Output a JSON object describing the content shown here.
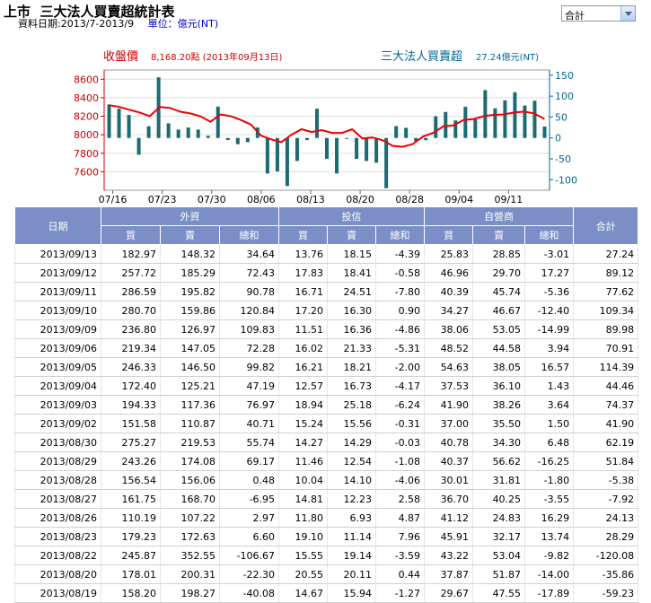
{
  "header": {
    "title_market": "上市",
    "title_main": "三大法人買賣超統計表",
    "date_range": "資料日期:2013/7-2013/9",
    "unit_label": "單位：億元(NT)"
  },
  "filter": {
    "selected": "合計"
  },
  "chart_legend": {
    "price_label": "收盤價",
    "price_value": "8,168.20點 (2013年09月13日)",
    "net_label": "三大法人買賣超",
    "net_value": "27.24億元(NT)"
  },
  "chart_data": {
    "type": "bar+line",
    "x_tick_labels": [
      "07/16",
      "07/23",
      "07/30",
      "08/06",
      "08/13",
      "08/20",
      "08/28",
      "09/04",
      "09/11"
    ],
    "left_axis": {
      "label": "收盤價",
      "ticks": [
        7600,
        7800,
        8000,
        8200,
        8400,
        8600
      ],
      "range": [
        7400,
        8700
      ],
      "color": "#cc0000"
    },
    "right_axis": {
      "label": "三大法人買賣超",
      "ticks": [
        -100,
        -50,
        0,
        50,
        100,
        150
      ],
      "range": [
        -125,
        162.5
      ],
      "color": "#006699"
    },
    "dates": [
      "07/16",
      "07/17",
      "07/18",
      "07/19",
      "07/22",
      "07/23",
      "07/24",
      "07/25",
      "07/26",
      "07/29",
      "07/30",
      "07/31",
      "08/01",
      "08/02",
      "08/05",
      "08/06",
      "08/07",
      "08/08",
      "08/09",
      "08/12",
      "08/13",
      "08/14",
      "08/15",
      "08/16",
      "08/19",
      "08/20",
      "08/21",
      "08/22",
      "08/23",
      "08/26",
      "08/27",
      "08/28",
      "08/29",
      "08/30",
      "09/02",
      "09/03",
      "09/04",
      "09/05",
      "09/06",
      "09/09",
      "09/10",
      "09/11",
      "09/12",
      "09/13"
    ],
    "net_buy_sell": [
      80,
      70,
      55,
      -40,
      28,
      145,
      35,
      20,
      25,
      20,
      5,
      75,
      -5,
      -15,
      -10,
      25,
      -85,
      -80,
      -115,
      -55,
      -5,
      70,
      -50,
      -85,
      0,
      -50,
      -55,
      -59.23,
      -120.08,
      28.29,
      24.13,
      -7.92,
      -5.38,
      51.84,
      62.19,
      41.9,
      74.37,
      44.46,
      114.39,
      70.91,
      89.98,
      109.34,
      77.62,
      89.12,
      27.24
    ],
    "close_price": [
      8320,
      8300,
      8270,
      8240,
      8200,
      8300,
      8290,
      8250,
      8230,
      8200,
      8140,
      8220,
      8200,
      8160,
      8110,
      7990,
      7950,
      7920,
      8000,
      8060,
      8030,
      8050,
      8020,
      8020,
      8060,
      7960,
      7970,
      7940,
      7880,
      7870,
      7900,
      7980,
      8020,
      8090,
      8100,
      8160,
      8170,
      8200,
      8215,
      8220,
      8240,
      8250,
      8230,
      8168.2
    ]
  },
  "table": {
    "headers": {
      "date": "日期",
      "foreign": "外資",
      "trust": "投信",
      "dealer": "自營商",
      "total": "合計",
      "buy": "買",
      "sell": "賣",
      "net": "總和"
    },
    "rows": [
      {
        "date": "2013/09/13",
        "f_buy": "182.97",
        "f_sell": "148.32",
        "f_net": "34.64",
        "t_buy": "13.76",
        "t_sell": "18.15",
        "t_net": "-4.39",
        "d_buy": "25.83",
        "d_sell": "28.85",
        "d_net": "-3.01",
        "total": "27.24"
      },
      {
        "date": "2013/09/12",
        "f_buy": "257.72",
        "f_sell": "185.29",
        "f_net": "72.43",
        "t_buy": "17.83",
        "t_sell": "18.41",
        "t_net": "-0.58",
        "d_buy": "46.96",
        "d_sell": "29.70",
        "d_net": "17.27",
        "total": "89.12"
      },
      {
        "date": "2013/09/11",
        "f_buy": "286.59",
        "f_sell": "195.82",
        "f_net": "90.78",
        "t_buy": "16.71",
        "t_sell": "24.51",
        "t_net": "-7.80",
        "d_buy": "40.39",
        "d_sell": "45.74",
        "d_net": "-5.36",
        "total": "77.62"
      },
      {
        "date": "2013/09/10",
        "f_buy": "280.70",
        "f_sell": "159.86",
        "f_net": "120.84",
        "t_buy": "17.20",
        "t_sell": "16.30",
        "t_net": "0.90",
        "d_buy": "34.27",
        "d_sell": "46.67",
        "d_net": "-12.40",
        "total": "109.34"
      },
      {
        "date": "2013/09/09",
        "f_buy": "236.80",
        "f_sell": "126.97",
        "f_net": "109.83",
        "t_buy": "11.51",
        "t_sell": "16.36",
        "t_net": "-4.86",
        "d_buy": "38.06",
        "d_sell": "53.05",
        "d_net": "-14.99",
        "total": "89.98"
      },
      {
        "date": "2013/09/06",
        "f_buy": "219.34",
        "f_sell": "147.05",
        "f_net": "72.28",
        "t_buy": "16.02",
        "t_sell": "21.33",
        "t_net": "-5.31",
        "d_buy": "48.52",
        "d_sell": "44.58",
        "d_net": "3.94",
        "total": "70.91"
      },
      {
        "date": "2013/09/05",
        "f_buy": "246.33",
        "f_sell": "146.50",
        "f_net": "99.82",
        "t_buy": "16.21",
        "t_sell": "18.21",
        "t_net": "-2.00",
        "d_buy": "54.63",
        "d_sell": "38.05",
        "d_net": "16.57",
        "total": "114.39"
      },
      {
        "date": "2013/09/04",
        "f_buy": "172.40",
        "f_sell": "125.21",
        "f_net": "47.19",
        "t_buy": "12.57",
        "t_sell": "16.73",
        "t_net": "-4.17",
        "d_buy": "37.53",
        "d_sell": "36.10",
        "d_net": "1.43",
        "total": "44.46"
      },
      {
        "date": "2013/09/03",
        "f_buy": "194.33",
        "f_sell": "117.36",
        "f_net": "76.97",
        "t_buy": "18.94",
        "t_sell": "25.18",
        "t_net": "-6.24",
        "d_buy": "41.90",
        "d_sell": "38.26",
        "d_net": "3.64",
        "total": "74.37"
      },
      {
        "date": "2013/09/02",
        "f_buy": "151.58",
        "f_sell": "110.87",
        "f_net": "40.71",
        "t_buy": "15.24",
        "t_sell": "15.56",
        "t_net": "-0.31",
        "d_buy": "37.00",
        "d_sell": "35.50",
        "d_net": "1.50",
        "total": "41.90"
      },
      {
        "date": "2013/08/30",
        "f_buy": "275.27",
        "f_sell": "219.53",
        "f_net": "55.74",
        "t_buy": "14.27",
        "t_sell": "14.29",
        "t_net": "-0.03",
        "d_buy": "40.78",
        "d_sell": "34.30",
        "d_net": "6.48",
        "total": "62.19"
      },
      {
        "date": "2013/08/29",
        "f_buy": "243.26",
        "f_sell": "174.08",
        "f_net": "69.17",
        "t_buy": "11.46",
        "t_sell": "12.54",
        "t_net": "-1.08",
        "d_buy": "40.37",
        "d_sell": "56.62",
        "d_net": "-16.25",
        "total": "51.84"
      },
      {
        "date": "2013/08/28",
        "f_buy": "156.54",
        "f_sell": "156.06",
        "f_net": "0.48",
        "t_buy": "10.04",
        "t_sell": "14.10",
        "t_net": "-4.06",
        "d_buy": "30.01",
        "d_sell": "31.81",
        "d_net": "-1.80",
        "total": "-5.38"
      },
      {
        "date": "2013/08/27",
        "f_buy": "161.75",
        "f_sell": "168.70",
        "f_net": "-6.95",
        "t_buy": "14.81",
        "t_sell": "12.23",
        "t_net": "2.58",
        "d_buy": "36.70",
        "d_sell": "40.25",
        "d_net": "-3.55",
        "total": "-7.92"
      },
      {
        "date": "2013/08/26",
        "f_buy": "110.19",
        "f_sell": "107.22",
        "f_net": "2.97",
        "t_buy": "11.80",
        "t_sell": "6.93",
        "t_net": "4.87",
        "d_buy": "41.12",
        "d_sell": "24.83",
        "d_net": "16.29",
        "total": "24.13"
      },
      {
        "date": "2013/08/23",
        "f_buy": "179.23",
        "f_sell": "172.63",
        "f_net": "6.60",
        "t_buy": "19.10",
        "t_sell": "11.14",
        "t_net": "7.96",
        "d_buy": "45.91",
        "d_sell": "32.17",
        "d_net": "13.74",
        "total": "28.29"
      },
      {
        "date": "2013/08/22",
        "f_buy": "245.87",
        "f_sell": "352.55",
        "f_net": "-106.67",
        "t_buy": "15.55",
        "t_sell": "19.14",
        "t_net": "-3.59",
        "d_buy": "43.22",
        "d_sell": "53.04",
        "d_net": "-9.82",
        "total": "-120.08"
      },
      {
        "date": "2013/08/20",
        "f_buy": "178.01",
        "f_sell": "200.31",
        "f_net": "-22.30",
        "t_buy": "20.55",
        "t_sell": "20.11",
        "t_net": "0.44",
        "d_buy": "37.87",
        "d_sell": "51.87",
        "d_net": "-14.00",
        "total": "-35.86"
      },
      {
        "date": "2013/08/19",
        "f_buy": "158.20",
        "f_sell": "198.27",
        "f_net": "-40.08",
        "t_buy": "14.67",
        "t_sell": "15.94",
        "t_net": "-1.27",
        "d_buy": "29.67",
        "d_sell": "47.55",
        "d_net": "-17.89",
        "total": "-59.23"
      }
    ]
  }
}
